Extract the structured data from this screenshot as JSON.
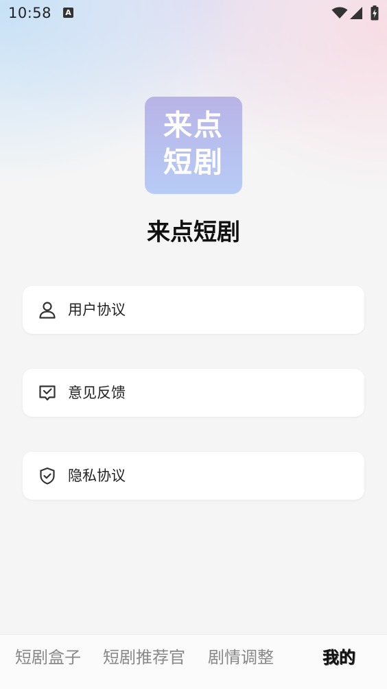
{
  "status_bar": {
    "time": "10:58",
    "notification_icon": "A"
  },
  "app": {
    "logo_line1": "来点",
    "logo_line2": "短剧",
    "name": "来点短剧"
  },
  "menu": {
    "items": [
      {
        "label": "用户协议",
        "icon": "user-icon"
      },
      {
        "label": "意见反馈",
        "icon": "feedback-icon"
      },
      {
        "label": "隐私协议",
        "icon": "shield-check-icon"
      }
    ]
  },
  "tabs": {
    "items": [
      {
        "label": "短剧盒子",
        "active": false
      },
      {
        "label": "短剧推荐官",
        "active": false
      },
      {
        "label": "剧情调整",
        "active": false
      },
      {
        "label": "我的",
        "active": true
      }
    ]
  },
  "colors": {
    "logo_gradient_top": "#b9b3e6",
    "logo_gradient_bottom": "#b6ccf6",
    "background": "#f5f5f5",
    "card": "#ffffff"
  }
}
